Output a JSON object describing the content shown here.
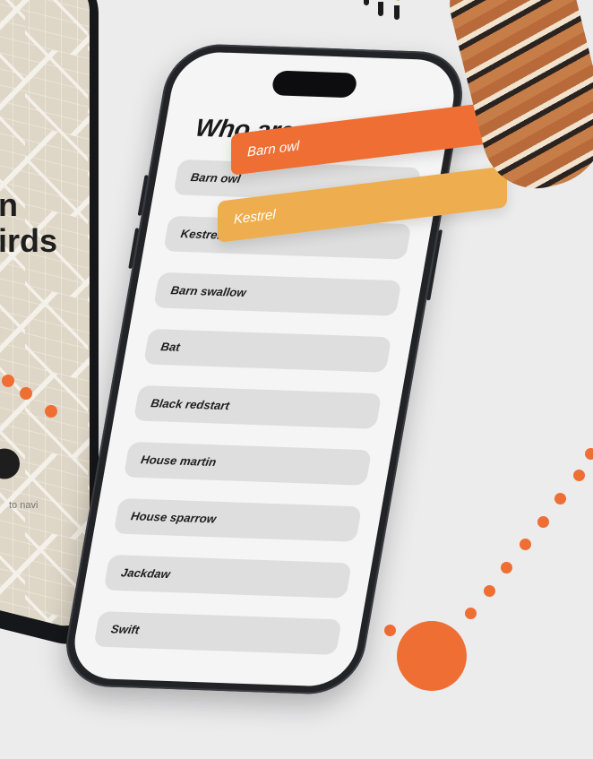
{
  "back_phone": {
    "title_partial": "n\nirds",
    "hint_partial": "to navi"
  },
  "screen": {
    "title": "Who are we ?",
    "items": [
      "Barn owl",
      "Kestrel",
      "Barn swallow",
      "Bat",
      "Black redstart",
      "House martin",
      "House sparrow",
      "Jackdaw",
      "Swift"
    ]
  },
  "floating_tags": [
    {
      "label": "Barn owl",
      "color": "#ef6e34"
    },
    {
      "label": "Kestrel",
      "color": "#eeae4f"
    }
  ],
  "accent_color": "#ef6e34",
  "icons": [
    "kestrel-bird-icon",
    "navigation-arrow-icon",
    "dynamic-island-icon"
  ]
}
